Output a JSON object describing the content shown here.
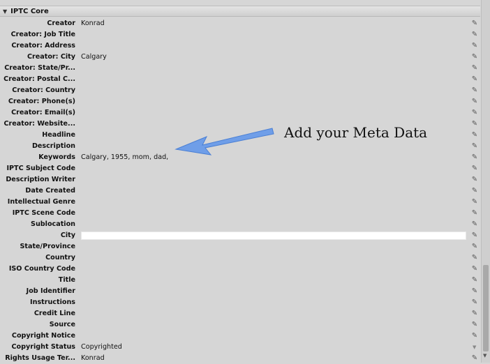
{
  "section": {
    "title": "IPTC Core"
  },
  "annotation": {
    "text": "Add your Meta Data",
    "arrow_color": "#6f9ee8"
  },
  "rows": [
    {
      "label": "Creator",
      "value": "Konrad"
    },
    {
      "label": "Creator: Job Title",
      "value": ""
    },
    {
      "label": "Creator: Address",
      "value": ""
    },
    {
      "label": "Creator: City",
      "value": "Calgary"
    },
    {
      "label": "Creator: State/Pr...",
      "value": ""
    },
    {
      "label": "Creator: Postal C...",
      "value": ""
    },
    {
      "label": "Creator: Country",
      "value": ""
    },
    {
      "label": "Creator: Phone(s)",
      "value": ""
    },
    {
      "label": "Creator: Email(s)",
      "value": ""
    },
    {
      "label": "Creator: Website...",
      "value": ""
    },
    {
      "label": "Headline",
      "value": ""
    },
    {
      "label": "Description",
      "value": ""
    },
    {
      "label": "Keywords",
      "value": "Calgary, 1955, mom, dad,"
    },
    {
      "label": "IPTC Subject Code",
      "value": ""
    },
    {
      "label": "Description Writer",
      "value": ""
    },
    {
      "label": "Date Created",
      "value": ""
    },
    {
      "label": "Intellectual Genre",
      "value": ""
    },
    {
      "label": "IPTC Scene Code",
      "value": ""
    },
    {
      "label": "Sublocation",
      "value": ""
    },
    {
      "label": "City",
      "value": ""
    },
    {
      "label": "State/Province",
      "value": ""
    },
    {
      "label": "Country",
      "value": ""
    },
    {
      "label": "ISO Country Code",
      "value": ""
    },
    {
      "label": "Title",
      "value": ""
    },
    {
      "label": "Job Identifier",
      "value": ""
    },
    {
      "label": "Instructions",
      "value": ""
    },
    {
      "label": "Credit Line",
      "value": ""
    },
    {
      "label": "Source",
      "value": ""
    },
    {
      "label": "Copyright Notice",
      "value": ""
    },
    {
      "label": "Copyright Status",
      "value": "Copyrighted"
    },
    {
      "label": "Rights Usage Ter...",
      "value": "Konrad"
    }
  ]
}
